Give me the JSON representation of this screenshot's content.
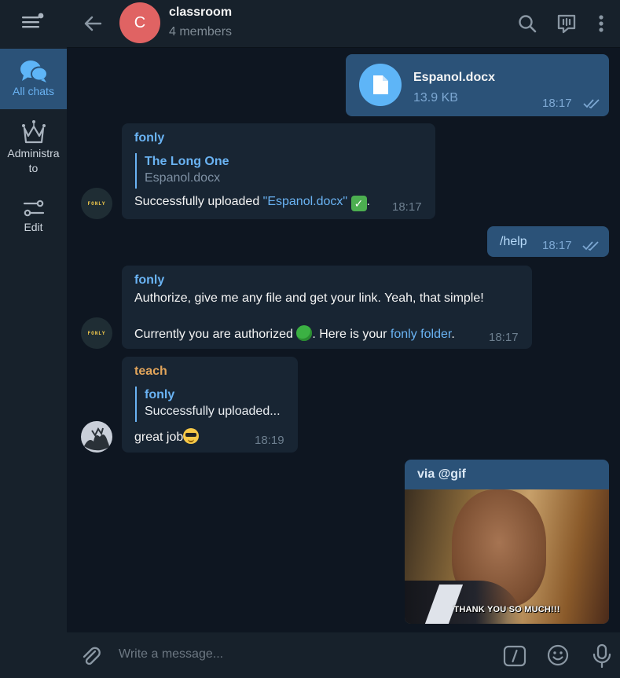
{
  "sidebar": {
    "items": [
      {
        "label": "All chats",
        "icon": "chats-icon"
      },
      {
        "label": "Administrato",
        "icon": "crown-icon"
      },
      {
        "label": "Edit",
        "icon": "sliders-icon"
      }
    ],
    "admin_line1": "Administra",
    "admin_line2": "to"
  },
  "header": {
    "avatar_letter": "C",
    "title": "classroom",
    "subtitle": "4 members",
    "avatar_color": "#e06363"
  },
  "messages": {
    "file": {
      "name": "Espanol.docx",
      "size": "13.9 KB",
      "time": "18:17"
    },
    "bot_upload": {
      "sender": "fonly",
      "quote_title": "The Long One",
      "quote_body": "Espanol.docx",
      "text_prefix": "Successfully uploaded ",
      "text_link": "\"Espanol.docx\"",
      "time": "18:17",
      "avatar_text": "FONLY"
    },
    "help": {
      "text": "/help",
      "time": "18:17"
    },
    "bot_auth": {
      "sender": "fonly",
      "line1": "Authorize, give me any file and get your link. Yeah, that simple!",
      "line2_prefix": "Currently you are authorized ",
      "line2_mid": ". Here is your ",
      "line2_link": "fonly folder",
      "line2_suffix": ".",
      "time": "18:17",
      "avatar_text": "FONLY"
    },
    "teach": {
      "sender": "teach",
      "quote_title": "fonly",
      "quote_body": "Successfully uploaded...",
      "text": "great job",
      "time": "18:19"
    },
    "gif": {
      "via": "via @gif",
      "caption": "THANK YOU SO MUCH!!!"
    }
  },
  "composer": {
    "placeholder": "Write a message..."
  },
  "colors": {
    "background": "#0e1621",
    "panel": "#17212b",
    "incoming": "#182533",
    "outgoing": "#2b5278",
    "accent": "#6ab3f3"
  }
}
